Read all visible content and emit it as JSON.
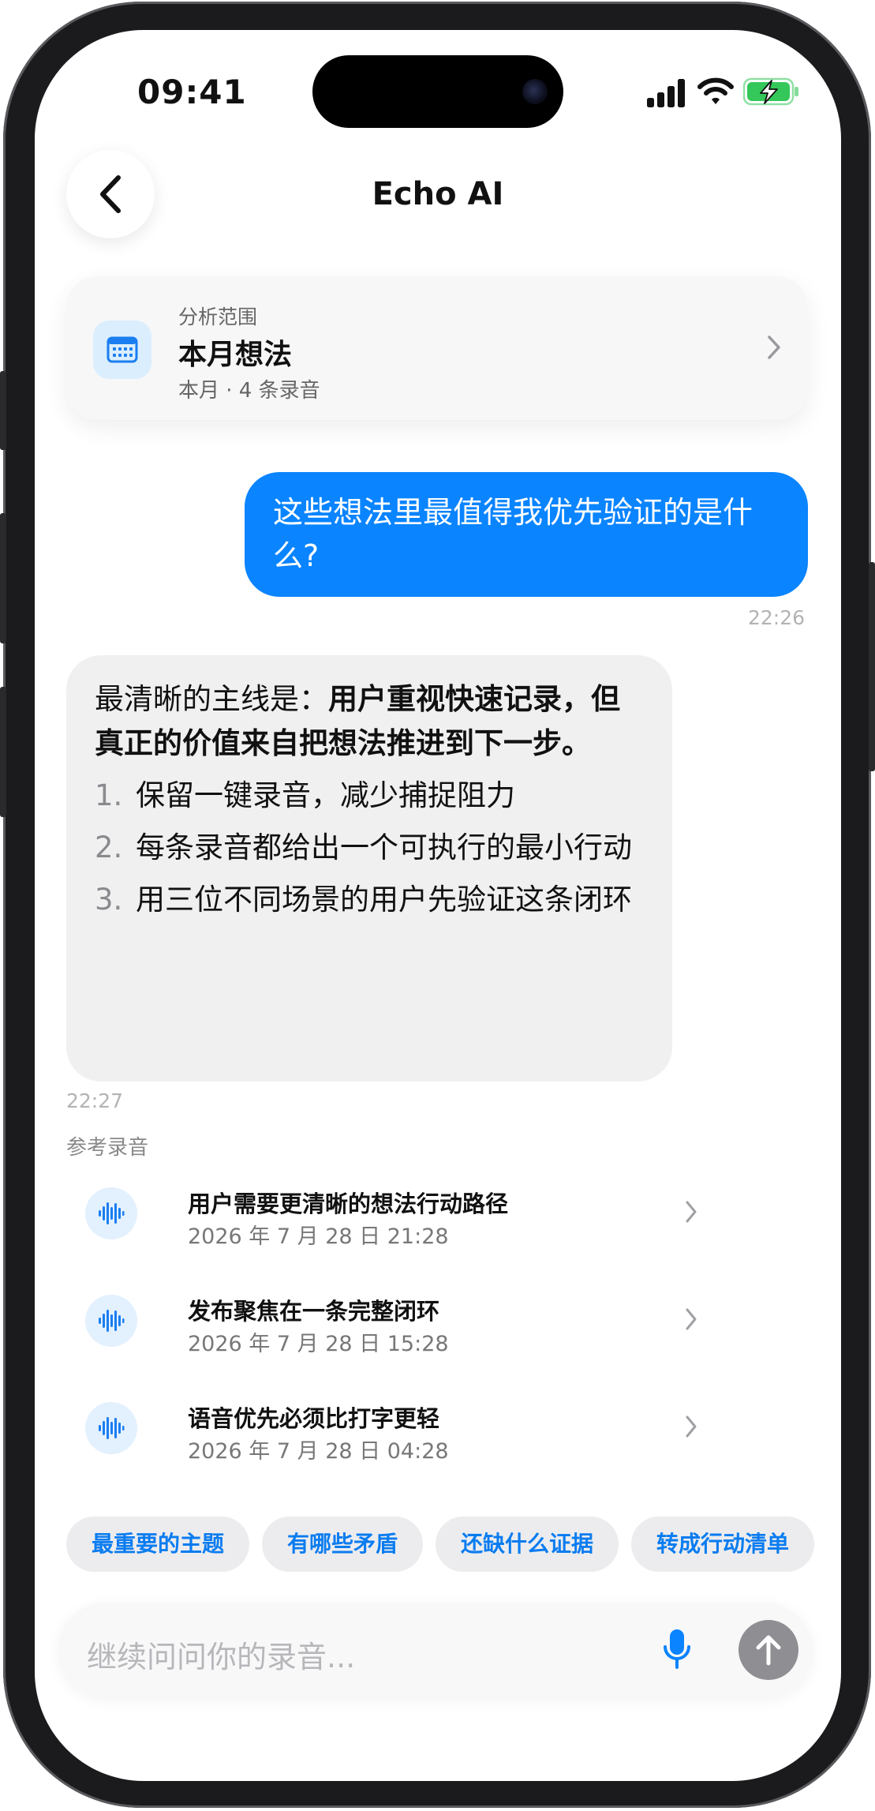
{
  "status_bar": {
    "time": "09:41"
  },
  "header": {
    "title": "Echo AI"
  },
  "scope_card": {
    "kicker": "分析范围",
    "title": "本月想法",
    "subtitle": "本月 · 4 条录音"
  },
  "messages": {
    "user": {
      "text": "这些想法里最值得我优先验证的是什么?",
      "time": "22:26"
    },
    "ai": {
      "lead_plain": "最清晰的主线是：",
      "lead_bold": "用户重视快速记录，但真正的价值来自把想法推进到下一步。",
      "items": [
        {
          "num": "1.",
          "text": "保留一键录音，减少捕捉阻力"
        },
        {
          "num": "2.",
          "text": "每条录音都给出一个可执行的最小行动"
        },
        {
          "num": "3.",
          "text": "用三位不同场景的用户先验证这条闭环"
        }
      ],
      "time": "22:27"
    }
  },
  "references": {
    "label": "参考录音",
    "items": [
      {
        "title": "用户需要更清晰的想法行动路径",
        "date": "2026 年 7 月 28 日 21:28"
      },
      {
        "title": "发布聚焦在一条完整闭环",
        "date": "2026 年 7 月 28 日 15:28"
      },
      {
        "title": "语音优先必须比打字更轻",
        "date": "2026 年 7 月 28 日 04:28"
      }
    ]
  },
  "suggestions": [
    "最重要的主题",
    "有哪些矛盾",
    "还缺什么证据",
    "转成行动清单"
  ],
  "composer": {
    "placeholder": "继续问问你的录音..."
  },
  "colors": {
    "accent": "#0a84ff",
    "battery": "#34c759",
    "bubble_gray": "#f0f0f1"
  },
  "icons": [
    "back-chevron-icon",
    "calendar-icon",
    "chevron-right-icon",
    "waveform-icon",
    "mic-icon",
    "arrow-up-icon",
    "cellular-icon",
    "wifi-icon",
    "battery-charging-icon"
  ]
}
